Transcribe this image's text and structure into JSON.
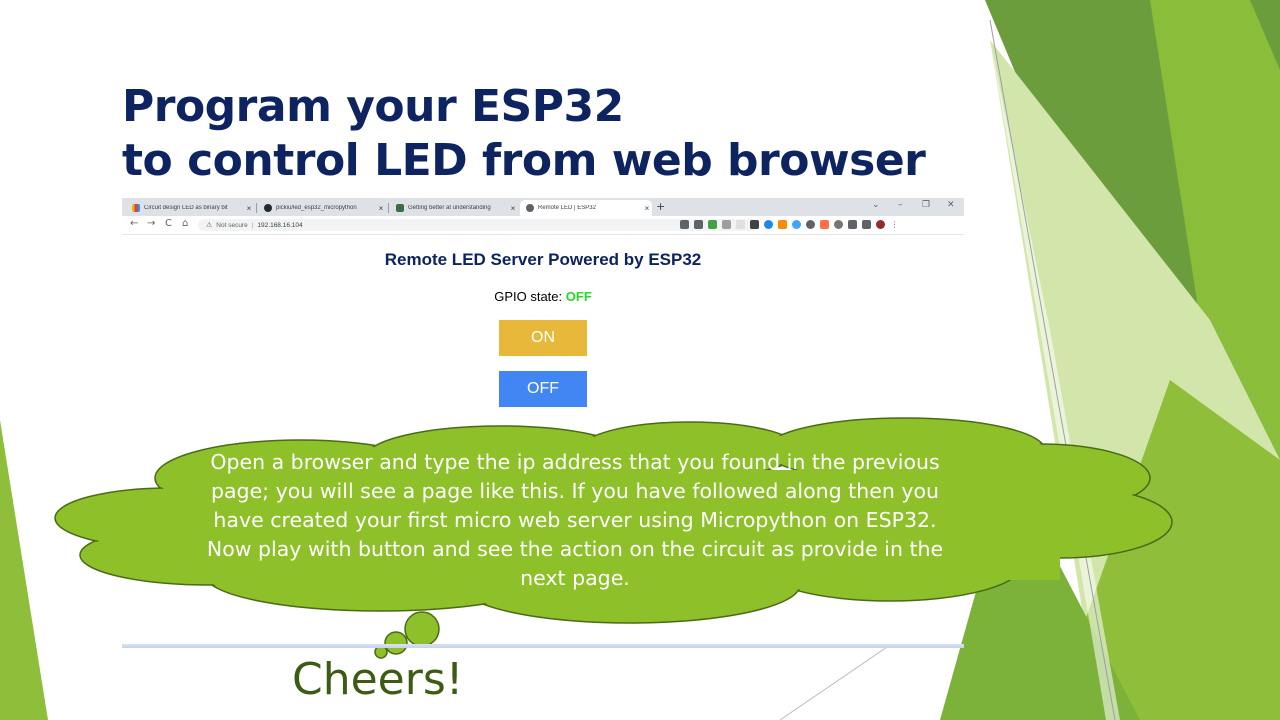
{
  "slide": {
    "title_line1": "Program your ESP32",
    "title_line2": "to control LED from web browser",
    "callout_text": "Open a browser and type the ip address that you found in the previous page; you will see a page like this. If you have followed along then you have created your first micro web server using Micropython on ESP32. Now play with button and see the action on the circuit as provide in the next page.",
    "closing": "Cheers!",
    "colors": {
      "title": "#0d2461",
      "cloud": "#8ec02a",
      "green_accent": "#7aab2e",
      "closing": "#3e5b14"
    }
  },
  "browser": {
    "tabs": [
      {
        "label": "Circuit design LED as binary bit",
        "close": "×",
        "icon": "colorful-grid-icon",
        "active": false
      },
      {
        "label": "pickiu/led_esp32_micropython",
        "close": "×",
        "icon": "github-icon",
        "active": false
      },
      {
        "label": "Getting better at understanding",
        "close": "×",
        "icon": "image-icon",
        "active": false
      },
      {
        "label": "Remote LED | ESP32",
        "close": "×",
        "icon": "globe-icon",
        "active": true
      }
    ],
    "new_tab": "+",
    "window_controls": {
      "dropdown": "⌄",
      "minimize": "–",
      "restore": "❐",
      "close": "✕"
    },
    "nav": {
      "back": "←",
      "forward": "→",
      "reload": "C",
      "home": "⌂"
    },
    "address": {
      "security_icon": "⚠",
      "security_label": "Not secure",
      "separator": "|",
      "url": "192.168.16.104"
    }
  },
  "webpage": {
    "heading": "Remote LED Server Powered by ESP32",
    "gpio_label": "GPIO state:",
    "gpio_value": "OFF",
    "on_button": "ON",
    "off_button": "OFF",
    "colors": {
      "heading": "#0d2461",
      "state": "#22dd22",
      "on_button": "#e8b83a",
      "off_button": "#4286f4"
    }
  }
}
